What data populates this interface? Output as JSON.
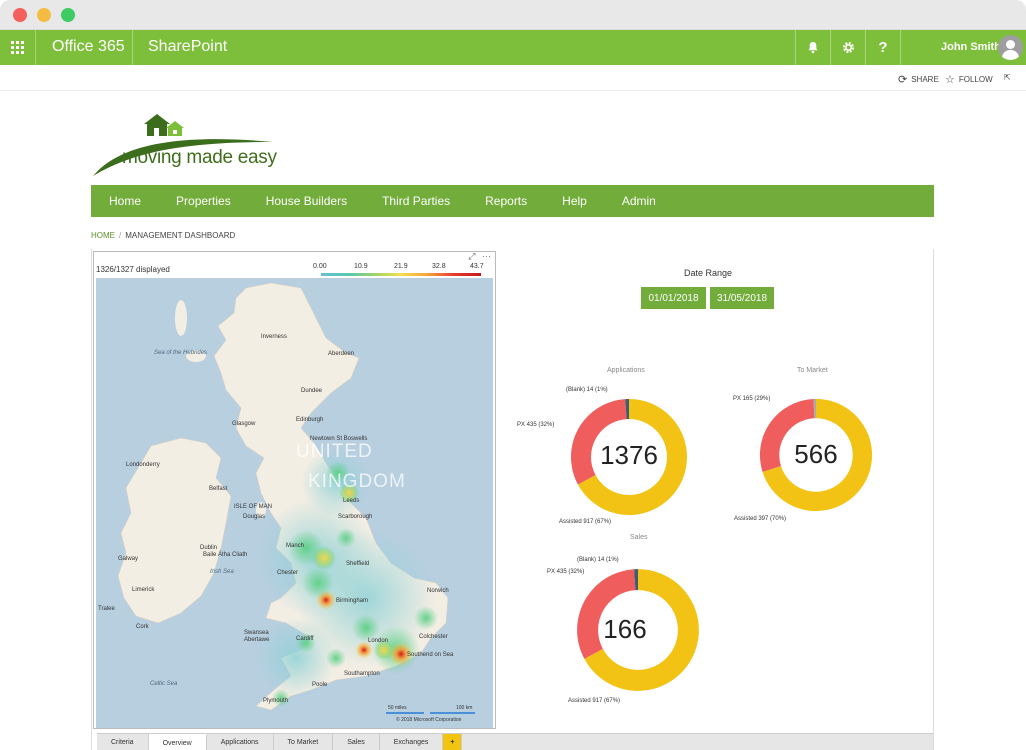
{
  "suite_bar": {
    "app_name": "Office 365",
    "site_name": "SharePoint",
    "user_name": "John Smith",
    "icons": [
      "bell-icon",
      "gear-icon",
      "help-icon"
    ]
  },
  "action_bar": {
    "share": "SHARE",
    "follow": "FOLLOW"
  },
  "logo": {
    "text": "moving made easy"
  },
  "nav": {
    "items": [
      {
        "label": "Home"
      },
      {
        "label": "Properties"
      },
      {
        "label": "House Builders"
      },
      {
        "label": "Third Parties"
      },
      {
        "label": "Reports"
      },
      {
        "label": "Help"
      },
      {
        "label": "Admin"
      }
    ]
  },
  "breadcrumb": {
    "home": "HOME",
    "current": "MANAGEMENT DASHBOARD"
  },
  "map": {
    "count_text": "1326/1327 displayed",
    "legend_ticks": [
      "0.00",
      "10.9",
      "21.9",
      "32.8",
      "43.7"
    ],
    "labels": {
      "sea_hebrides": "Sea of the Hebrides",
      "inverness": "Inverness",
      "aberdeen": "Aberdeen",
      "dundee": "Dundee",
      "edinburgh": "Edinburgh",
      "glasgow": "Glasgow",
      "newtown": "Newtown St Boswells",
      "united": "UNITED",
      "kingdom": "KINGDOM",
      "londonderry": "Londonderry",
      "belfast": "Belfast",
      "isle_of_man": "ISLE OF MAN",
      "douglas": "Douglas",
      "scarborough": "Scarborough",
      "leeds": "Leeds",
      "manchester": "Manch",
      "galway": "Galway",
      "dublin": "Dublin",
      "baile_atha_cliath": "Baile Átha Cliath",
      "irish_sea": "Irish Sea",
      "chester": "Chester",
      "sheffield": "Sheffield",
      "birmingham": "Birmingham",
      "norwich": "Norwich",
      "limerick": "Limerick",
      "tralee": "Tralee",
      "cork": "Cork",
      "swansea": "Swansea",
      "abertawe": "Abertawe",
      "cardiff": "Cardiff",
      "london": "London",
      "colchester": "Colchester",
      "southend": "Southend on Sea",
      "southampton": "Southampton",
      "poole": "Poole",
      "plymouth": "Plymouth",
      "celtic_sea": "Celtic Sea"
    },
    "scale_miles": "50 miles",
    "scale_km": "100 km",
    "copyright": "© 2018 Microsoft Corporation"
  },
  "date_range": {
    "title": "Date Range",
    "start": "01/01/2018",
    "end": "31/05/2018"
  },
  "donuts": [
    {
      "title": "Applications",
      "total": "1376",
      "callouts": [
        "(Blank) 14 (1%)",
        "PX 435 (32%)",
        "Assisted 917 (67%)"
      ],
      "slices": [
        {
          "name": "Assisted",
          "value": 917,
          "color": "#f2c314"
        },
        {
          "name": "PX",
          "value": 435,
          "color": "#f05d5d"
        },
        {
          "name": "(Blank)",
          "value": 14,
          "color": "#3d5b73"
        }
      ]
    },
    {
      "title": "To Market",
      "total": "566",
      "callouts": [
        "PX 165 (29%)",
        "Assisted 397 (70%)"
      ],
      "slices": [
        {
          "name": "Assisted",
          "value": 397,
          "color": "#f2c314"
        },
        {
          "name": "PX",
          "value": 165,
          "color": "#f05d5d"
        },
        {
          "name": "(Blank)",
          "value": 4,
          "color": "#aaaaaa"
        }
      ]
    },
    {
      "title": "Sales",
      "total": "166",
      "callouts": [
        "(Blank) 14 (1%)",
        "PX 435 (32%)",
        "Assisted 917 (67%)"
      ],
      "slices": [
        {
          "name": "Assisted",
          "value": 917,
          "color": "#f2c314"
        },
        {
          "name": "PX",
          "value": 435,
          "color": "#f05d5d"
        },
        {
          "name": "(Blank)",
          "value": 14,
          "color": "#3d5b73"
        }
      ]
    }
  ],
  "tabs": [
    {
      "label": "Criteria"
    },
    {
      "label": "Overview"
    },
    {
      "label": "Applications"
    },
    {
      "label": "To Market"
    },
    {
      "label": "Sales"
    },
    {
      "label": "Exchanges"
    },
    {
      "label": "+"
    }
  ],
  "active_tab": "Overview",
  "colors": {
    "brand_green": "#7dbf3a",
    "nav_green": "#72ac3a",
    "assisted": "#f2c314",
    "px": "#f05d5d"
  }
}
